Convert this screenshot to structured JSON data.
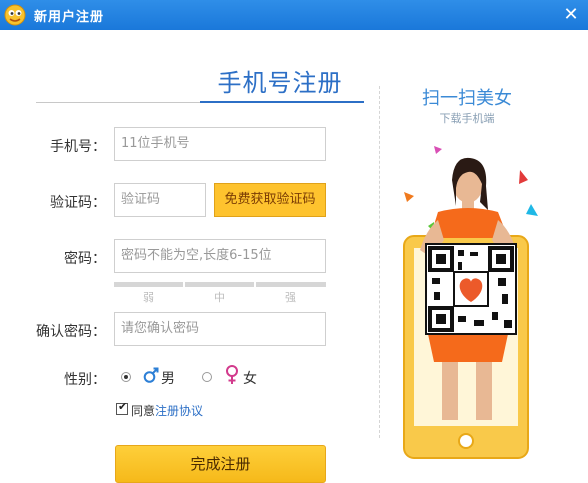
{
  "window": {
    "title": "新用户注册",
    "close_glyph": "✕"
  },
  "tab": {
    "active": "手机号注册"
  },
  "form": {
    "phone": {
      "label": "手机号：",
      "placeholder": "11位手机号"
    },
    "code": {
      "label": "验证码：",
      "placeholder": "验证码",
      "button": "免费获取验证码"
    },
    "password": {
      "label": "密码：",
      "placeholder": "密码不能为空,长度6-15位",
      "strength": [
        "弱",
        "中",
        "强"
      ]
    },
    "confirm": {
      "label": "确认密码：",
      "placeholder": "请您确认密码"
    },
    "gender": {
      "label": "性别：",
      "male": "男",
      "female": "女",
      "selected": "男"
    },
    "agreement": {
      "checked": true,
      "prefix": "同意",
      "link": "注册协议"
    },
    "submit": "完成注册"
  },
  "promo": {
    "title": "扫一扫美女",
    "subtitle": "下载手机端"
  },
  "colors": {
    "titlebar": "#1f82e2",
    "accent_blue": "#2c6fc6",
    "button_yellow": "#fec32e",
    "promo_orange": "#f56a1b"
  }
}
